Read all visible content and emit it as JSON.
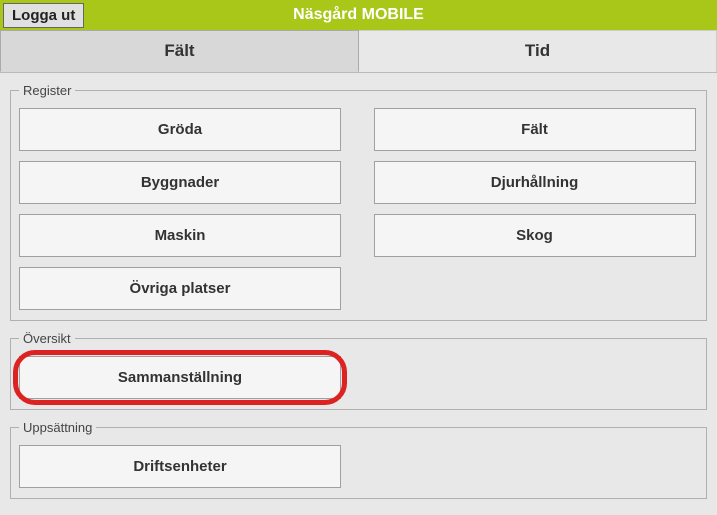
{
  "header": {
    "logout_label": "Logga ut",
    "app_title": "Näsgård MOBILE"
  },
  "tabs": {
    "field": "Fält",
    "time": "Tid"
  },
  "register": {
    "legend": "Register",
    "items": {
      "crop": "Gröda",
      "field": "Fält",
      "buildings": "Byggnader",
      "livestock": "Djurhållning",
      "machine": "Maskin",
      "forest": "Skog",
      "other_places": "Övriga platser"
    }
  },
  "overview": {
    "legend": "Översikt",
    "summary": "Sammanställning"
  },
  "setup": {
    "legend": "Uppsättning",
    "operating_units": "Driftsenheter"
  }
}
